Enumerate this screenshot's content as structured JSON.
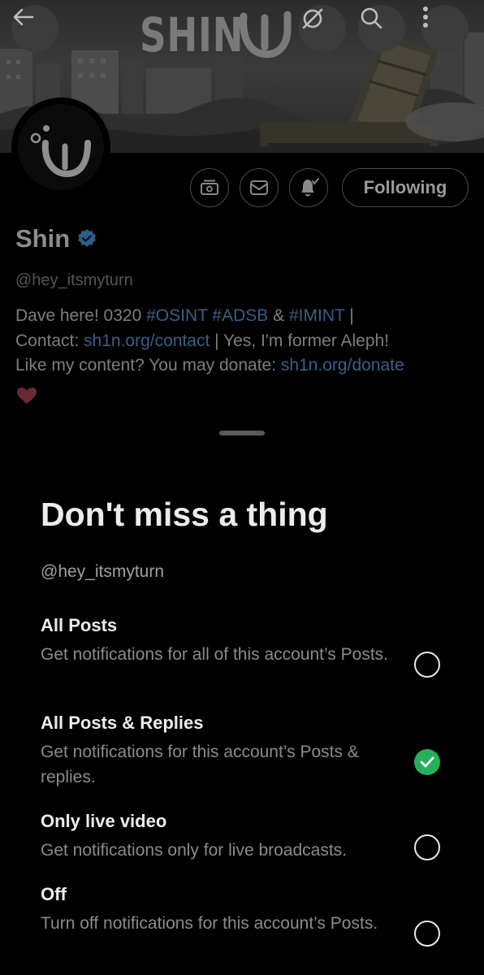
{
  "header": {
    "banner_wordmark": "SHIN",
    "back_icon": "arrow-left-icon",
    "dsync_icon": "circle-slash-icon",
    "search_icon": "search-icon",
    "more_icon": "more-vertical-icon"
  },
  "profile": {
    "name": "Shin",
    "verified": true,
    "handle": "@hey_itsmyturn",
    "bio": {
      "line1_prefix": "Dave here! 0320 ",
      "tag_osint": "#OSINT",
      "tag_adsb": "#ADSB",
      "amp": " & ",
      "tag_imint": "#IMINT",
      "pipe1": " |",
      "contact_label": "Contact: ",
      "contact_link": "sh1n.org/contact",
      "line2_suffix": " |  Yes, I'm former Aleph!",
      "donate_label": "Like my content? You may donate: ",
      "donate_link": "sh1n.org/donate"
    },
    "actions": {
      "subscribe_icon": "subscription-icon",
      "message_icon": "mail-icon",
      "notify_icon": "bell-check-icon",
      "following_label": "Following"
    }
  },
  "sheet": {
    "title": "Don't miss a thing",
    "handle": "@hey_itsmyturn",
    "options": [
      {
        "title": "All Posts",
        "description": "Get notifications for all of this account’s Posts.",
        "selected": false
      },
      {
        "title": "All Posts & Replies",
        "description": "Get notifications for this account’s Posts & replies.",
        "selected": true
      },
      {
        "title": "Only live video",
        "description": "Get notifications only for live broadcasts.",
        "selected": false
      },
      {
        "title": "Off",
        "description": "Turn off notifications for this account’s Posts.",
        "selected": false
      }
    ]
  },
  "colors": {
    "background": "#000000",
    "accent_link": "#1d9bf0",
    "selected_green": "#25b15a",
    "verified_blue": "#1d9bf0"
  }
}
